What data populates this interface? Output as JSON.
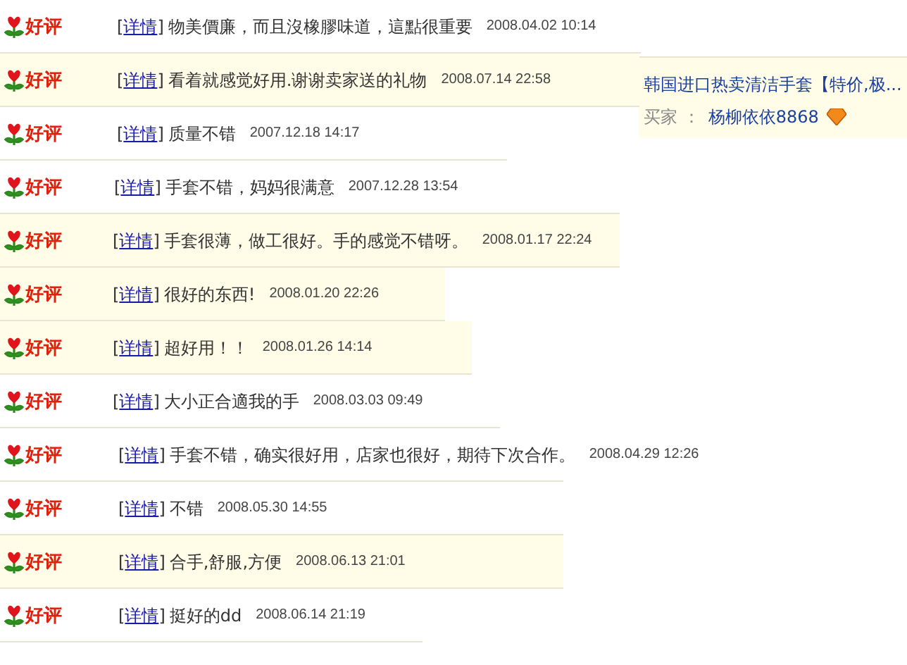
{
  "reviews": [
    {
      "rating": "好评",
      "bracket_open": "[",
      "link": "详情",
      "bracket_close": "]",
      "comment": "物美價廉，而且沒橡膠味道，這點很重要",
      "date": "2008.04.02 10:14",
      "shaded": false
    },
    {
      "rating": "好评",
      "bracket_open": "[",
      "link": "详情",
      "bracket_close": "]",
      "comment": "看着就感觉好用.谢谢卖家送的礼物",
      "date": "2008.07.14 22:58",
      "shaded": true
    },
    {
      "rating": "好评",
      "bracket_open": "[",
      "link": "详情",
      "bracket_close": "]",
      "comment": "质量不错",
      "date": "2007.12.18 14:17",
      "shaded": false
    },
    {
      "rating": "好评",
      "bracket_open": "[",
      "link": "详情",
      "bracket_close": "]",
      "comment": "手套不错，妈妈很满意",
      "date": "2007.12.28 13:54",
      "shaded": false
    },
    {
      "rating": "好评",
      "bracket_open": "[",
      "link": "详情",
      "bracket_close": "]",
      "comment": "手套很薄，做工很好。手的感觉不错呀。",
      "date": "2008.01.17 22:24",
      "shaded": true
    },
    {
      "rating": "好评",
      "bracket_open": "[",
      "link": "详情",
      "bracket_close": "]",
      "comment": "很好的东西!",
      "date": "2008.01.20 22:26",
      "shaded": true
    },
    {
      "rating": "好评",
      "bracket_open": "[",
      "link": "详情",
      "bracket_close": "]",
      "comment": "超好用！！",
      "date": "2008.01.26 14:14",
      "shaded": true
    },
    {
      "rating": "好评",
      "bracket_open": "[",
      "link": "详情",
      "bracket_close": "]",
      "comment": "大小正合適我的手",
      "date": "2008.03.03 09:49",
      "shaded": false
    },
    {
      "rating": "好评",
      "bracket_open": "[",
      "link": "详情",
      "bracket_close": "]",
      "comment": "手套不错，确实很好用，店家也很好，期待下次合作。",
      "date": "2008.04.29 12:26",
      "shaded": false
    },
    {
      "rating": "好评",
      "bracket_open": "[",
      "link": "详情",
      "bracket_close": "]",
      "comment": "不错",
      "date": "2008.05.30 14:55",
      "shaded": false
    },
    {
      "rating": "好评",
      "bracket_open": "[",
      "link": "详情",
      "bracket_close": "]",
      "comment": "合手,舒服,方便",
      "date": "2008.06.13 21:01",
      "shaded": true
    },
    {
      "rating": "好评",
      "bracket_open": "[",
      "link": "详情",
      "bracket_close": "]",
      "comment": "挺好的dd",
      "date": "2008.06.14 21:19",
      "shaded": false
    }
  ],
  "product": {
    "title": "韩国进口热卖清洁手套【特价,极...",
    "buyer_label": "买家 ：",
    "buyer": "杨柳依依8868"
  }
}
